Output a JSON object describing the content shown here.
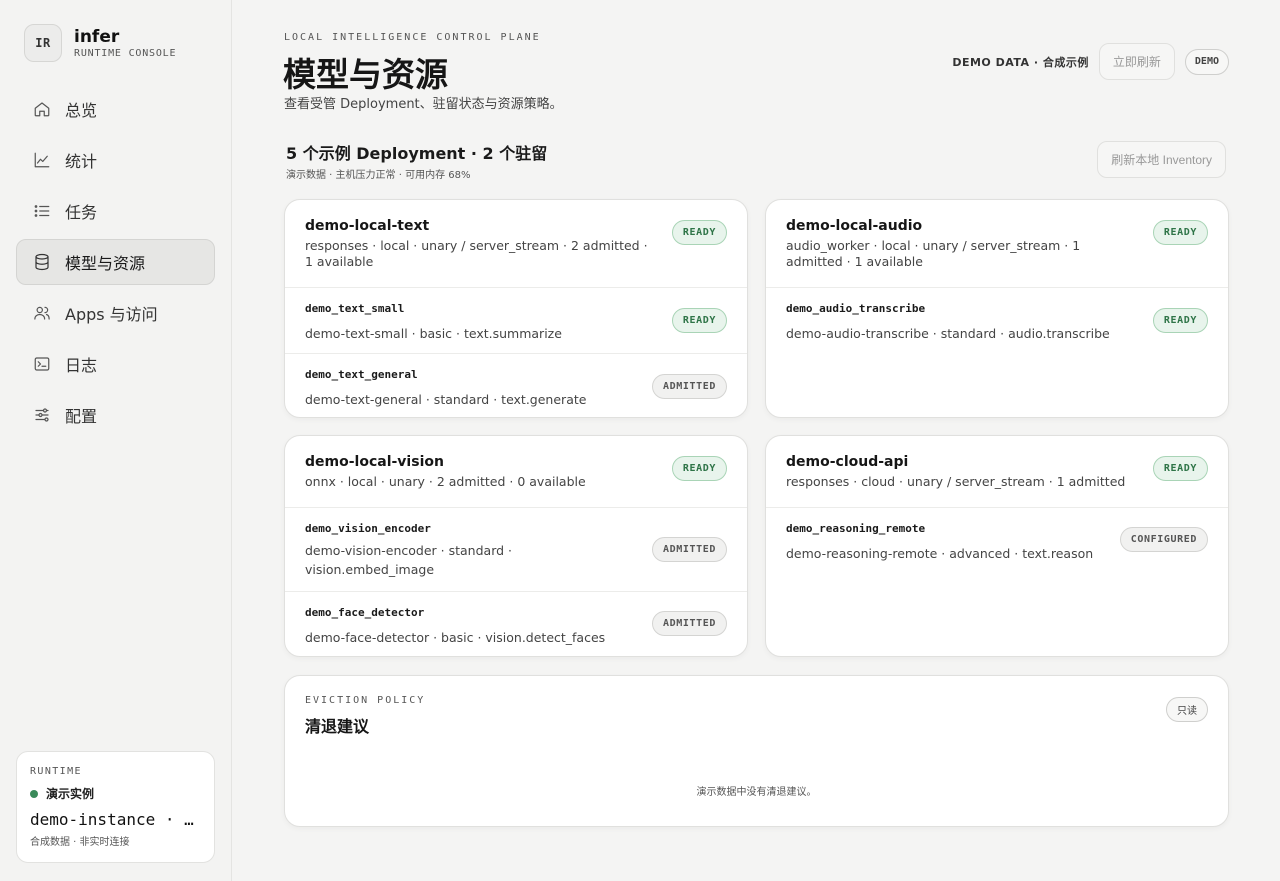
{
  "brand": {
    "logo": "IR",
    "name": "infer",
    "subtitle": "RUNTIME CONSOLE"
  },
  "nav": [
    {
      "label": "总览",
      "icon": "home-icon",
      "active": false
    },
    {
      "label": "统计",
      "icon": "line-chart-icon",
      "active": false
    },
    {
      "label": "任务",
      "icon": "list-icon",
      "active": false
    },
    {
      "label": "模型与资源",
      "icon": "database-icon",
      "active": true
    },
    {
      "label": "Apps 与访问",
      "icon": "users-icon",
      "active": false
    },
    {
      "label": "日志",
      "icon": "terminal-icon",
      "active": false
    },
    {
      "label": "配置",
      "icon": "sliders-icon",
      "active": false
    }
  ],
  "runtime": {
    "label": "RUNTIME",
    "status": "演示实例",
    "status_color": "#3a8a5a",
    "instance": "demo-instance · …",
    "note": "合成数据 · 非实时连接"
  },
  "header": {
    "eyebrow": "LOCAL INTELLIGENCE CONTROL PLANE",
    "title": "模型与资源",
    "subtitle": "查看受管 Deployment、驻留状态与资源策略。",
    "demo_data": "DEMO DATA · 合成示例",
    "refresh_label": "立即刷新",
    "demo_pill": "DEMO"
  },
  "summary": {
    "title": "5 个示例 Deployment · 2 个驻留",
    "subtitle": "演示数据 · 主机压力正常 · 可用内存 68%",
    "inventory_label": "刷新本地 Inventory"
  },
  "deployments": [
    {
      "title": "demo-local-text",
      "meta": "responses · local · unary / server_stream · 2 admitted · 1 available",
      "status": "READY",
      "models": [
        {
          "id": "demo_text_small",
          "meta": "demo-text-small · basic · text.summarize",
          "status": "READY"
        },
        {
          "id": "demo_text_general",
          "meta": "demo-text-general · standard · text.generate",
          "status": "ADMITTED"
        }
      ]
    },
    {
      "title": "demo-local-audio",
      "meta": "audio_worker · local · unary / server_stream · 1 admitted · 1 available",
      "status": "READY",
      "models": [
        {
          "id": "demo_audio_transcribe",
          "meta": "demo-audio-transcribe · standard · audio.transcribe",
          "status": "READY"
        }
      ]
    },
    {
      "title": "demo-local-vision",
      "meta": "onnx · local · unary · 2 admitted · 0 available",
      "status": "READY",
      "models": [
        {
          "id": "demo_vision_encoder",
          "meta": "demo-vision-encoder · standard · vision.embed_image",
          "status": "ADMITTED"
        },
        {
          "id": "demo_face_detector",
          "meta": "demo-face-detector · basic · vision.detect_faces",
          "status": "ADMITTED"
        }
      ]
    },
    {
      "title": "demo-cloud-api",
      "meta": "responses · cloud · unary / server_stream · 1 admitted",
      "status": "READY",
      "models": [
        {
          "id": "demo_reasoning_remote",
          "meta": "demo-reasoning-remote · advanced · text.reason",
          "status": "CONFIGURED"
        }
      ]
    }
  ],
  "eviction": {
    "eyebrow": "EVICTION POLICY",
    "title": "清退建议",
    "pill": "只读",
    "empty": "演示数据中没有清退建议。"
  },
  "colors": {
    "ready": "#2e7447",
    "ready_bg": "#e8f4ec",
    "accent_dot": "#3a8a5a"
  }
}
